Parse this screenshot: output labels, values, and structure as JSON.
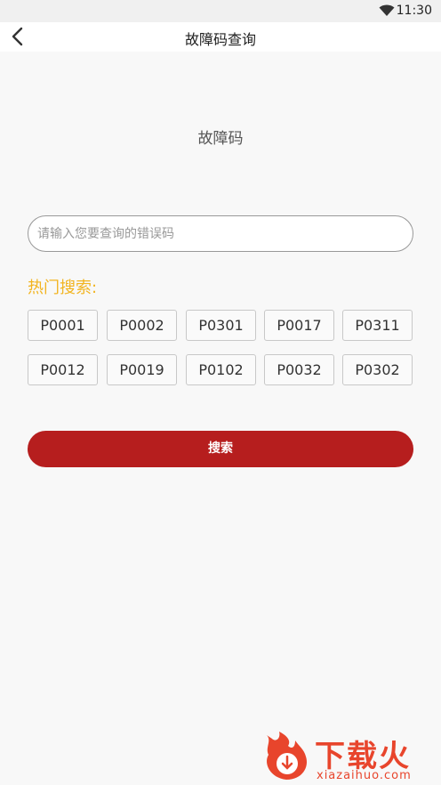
{
  "status_bar": {
    "time": "11:30"
  },
  "header": {
    "title": "故障码查询"
  },
  "page": {
    "heading": "故障码"
  },
  "search": {
    "placeholder": "请输入您要查询的错误码",
    "value": ""
  },
  "hot": {
    "label": "热门搜索:",
    "tags": [
      "P0001",
      "P0002",
      "P0301",
      "P0017",
      "P0311",
      "P0012",
      "P0019",
      "P0102",
      "P0032",
      "P0302"
    ]
  },
  "search_button": {
    "label": "搜索"
  },
  "watermark": {
    "brand": "下载火",
    "url": "xiazaihuo.com"
  },
  "colors": {
    "accent": "#b61e1e",
    "hot_label": "#f2b420",
    "watermark": "#e8452c"
  }
}
